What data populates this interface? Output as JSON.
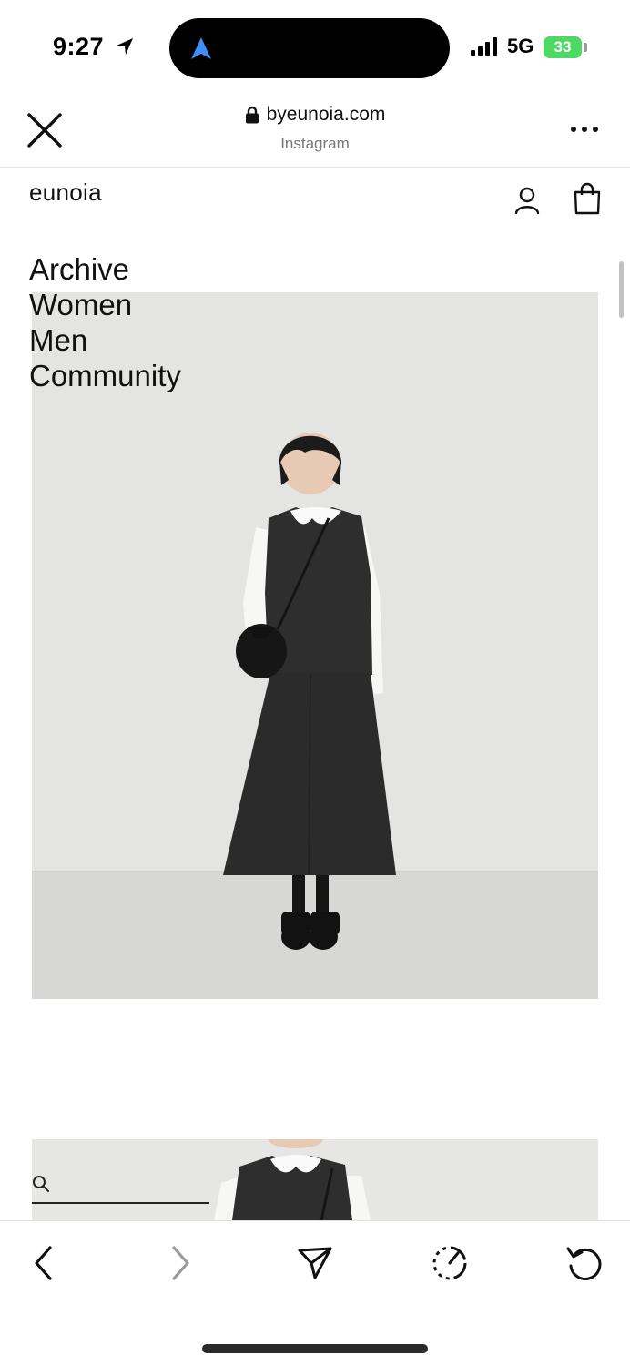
{
  "status_bar": {
    "time": "9:27",
    "network": "5G",
    "battery": "33"
  },
  "browser": {
    "domain": "byeunoia.com",
    "subtitle": "Instagram",
    "icons": [
      "close-icon",
      "lock-icon",
      "more-icon"
    ]
  },
  "site": {
    "logo": "eunoia",
    "icons": [
      "account-icon",
      "shopping-bag-icon"
    ]
  },
  "menu": {
    "items": [
      {
        "label": "Archive"
      },
      {
        "label": "Women"
      },
      {
        "label": "Men"
      },
      {
        "label": "Community"
      }
    ]
  },
  "toolbar": {
    "icons": [
      "back-icon",
      "forward-icon",
      "share-icon",
      "speed-icon",
      "reload-icon"
    ]
  },
  "colors": {
    "background": "#ffffff",
    "text": "#111111",
    "battery": "#4cd964",
    "photo_wall": "#e4e5e2",
    "photo_floor": "#d7d8d5"
  }
}
